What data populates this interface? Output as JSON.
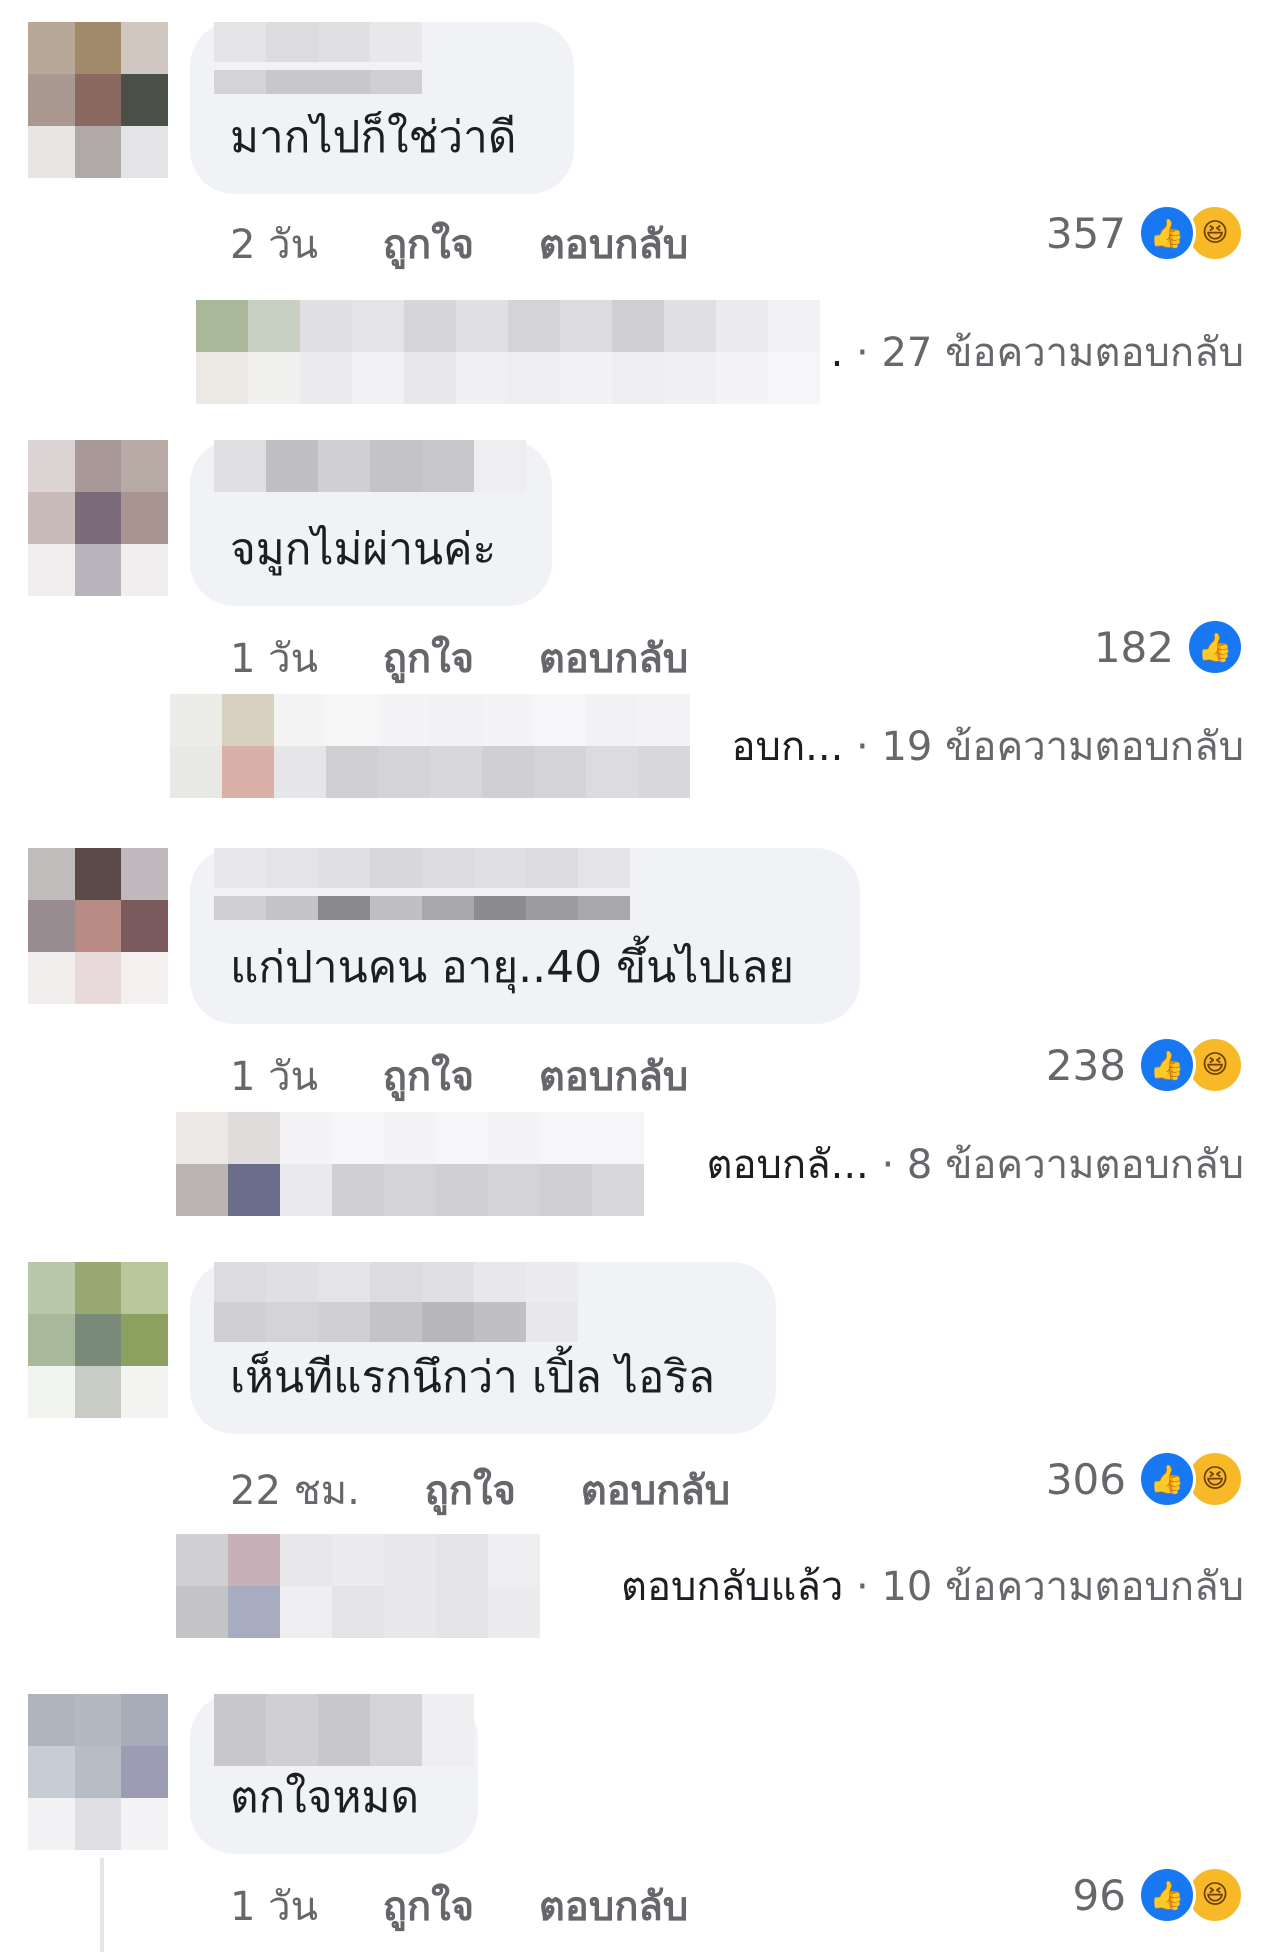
{
  "actions": {
    "like": "ถูกใจ",
    "reply": "ตอบกลับ"
  },
  "icons": {
    "like": "thumbs-up-icon",
    "haha": "laughing-face-icon"
  },
  "colors": {
    "like_blue": "#1877f2",
    "haha_yellow": "#f7b928",
    "bubble": "#f0f2f5",
    "meta_gray": "#65676b"
  },
  "comments": [
    {
      "text": "มากไปก็ใช่ว่าดี",
      "time": "2 วัน",
      "reaction_count": "357",
      "reactions": [
        "like",
        "haha"
      ],
      "reply_preview": ".",
      "reply_count": "· 27 ข้อความตอบกลับ"
    },
    {
      "text": "จมูกไม่ผ่านค่ะ",
      "time": "1 วัน",
      "reaction_count": "182",
      "reactions": [
        "like"
      ],
      "reply_preview": "อบก...",
      "reply_count": "· 19 ข้อความตอบกลับ"
    },
    {
      "text": "แก่ปานคน อายุ..40 ขึ้นไปเลย",
      "time": "1 วัน",
      "reaction_count": "238",
      "reactions": [
        "like",
        "haha"
      ],
      "reply_preview": "ตอบกลั...",
      "reply_count": "· 8 ข้อความตอบกลับ"
    },
    {
      "text": "เห็นทีแรกนึกว่า เปิ้ล ไอริล",
      "time": "22 ชม.",
      "reaction_count": "306",
      "reactions": [
        "like",
        "haha"
      ],
      "reply_preview": "ตอบกลับแล้ว",
      "reply_count": "· 10 ข้อความตอบกลับ"
    },
    {
      "text": "ตกใจหมด",
      "time": "1 วัน",
      "reaction_count": "96",
      "reactions": [
        "like",
        "haha"
      ]
    }
  ]
}
